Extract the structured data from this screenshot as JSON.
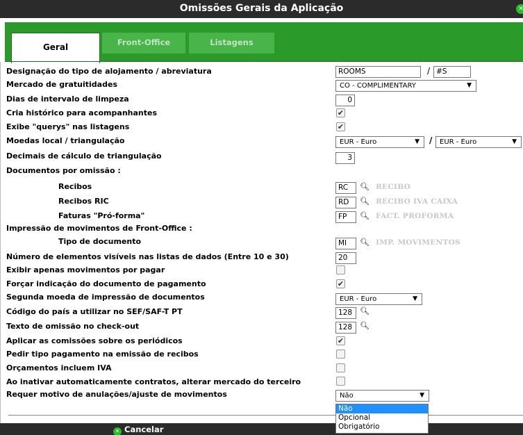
{
  "window": {
    "title": "Omissões Gerais da Aplicação"
  },
  "tabs": [
    {
      "label": "Geral",
      "active": true
    },
    {
      "label": "Front-Office",
      "active": false
    },
    {
      "label": "Listagens",
      "active": false
    }
  ],
  "fields": {
    "tipo_alojamento": {
      "label": "Designação do tipo de alojamento / abreviatura",
      "value": "ROOMS",
      "separator": "/",
      "abbr": "#S"
    },
    "mercado_gratuitidades": {
      "label": "Mercado de gratuitidades",
      "value": "CO - COMPLIMENTARY"
    },
    "dias_limpeza": {
      "label": "Dias de intervalo de limpeza",
      "value": "0"
    },
    "historico_acompanhantes": {
      "label": "Cria histórico para acompanhantes",
      "checked": true
    },
    "exibe_querys": {
      "label": "Exibe \"querys\" nas listagens",
      "checked": true
    },
    "moedas": {
      "label": "Moedas local / triangulação",
      "local": "EUR - Euro",
      "separator": "/",
      "triangulacao": "EUR - Euro"
    },
    "decimais": {
      "label": "Decimais de cálculo de triangulação",
      "value": "3"
    },
    "documentos_omissao": {
      "label": "Documentos por omissão :"
    },
    "recibos": {
      "label": "Recibos",
      "code": "RC",
      "desc": "RECIBO"
    },
    "recibos_ric": {
      "label": "Recibos RIC",
      "code": "RD",
      "desc": "RECIBO IVA CAIXA"
    },
    "faturas_proforma": {
      "label": "Faturas \"Pró-forma\"",
      "code": "FP",
      "desc": "FACT. PROFORMA"
    },
    "impressao_movimentos": {
      "label": "Impressão de movimentos de Front-Office :"
    },
    "tipo_documento": {
      "label": "Tipo de documento",
      "code": "MI",
      "desc": "IMP. MOVIMENTOS"
    },
    "num_elementos": {
      "label": "Número de elementos visíveis nas listas de dados (Entre 10 e 30)",
      "value": "20"
    },
    "exibir_por_pagar": {
      "label": "Exibir apenas movimentos por pagar",
      "checked": false
    },
    "forcar_indicacao": {
      "label": "Forçar indicação do documento de pagamento",
      "checked": true
    },
    "segunda_moeda": {
      "label": "Segunda moeda de impressão de documentos",
      "value": "EUR - Euro"
    },
    "codigo_pais": {
      "label": "Código do país a utilizar no SEF/SAF-T PT",
      "value": "128"
    },
    "texto_checkout": {
      "label": "Texto de omissão no check-out",
      "value": "128"
    },
    "comissoes_periodicos": {
      "label": "Aplicar as comissões sobre os periódicos",
      "checked": true
    },
    "pedir_tipo_pagamento": {
      "label": "Pedir tipo pagamento na emissão de recibos",
      "checked": false
    },
    "orcamentos_iva": {
      "label": "Orçamentos incluem IVA",
      "checked": false
    },
    "inativar_contratos": {
      "label": "Ao inativar automaticamente contratos, alterar mercado do terceiro",
      "checked": false
    },
    "motivo_anulacoes": {
      "label": "Requer motivo de anulações/ajuste de movimentos",
      "value": "Não",
      "options": [
        "Não",
        "Opcional",
        "Obrigatório"
      ]
    }
  },
  "footer": {
    "cancel_label": "Cancelar"
  },
  "colors": {
    "tab_green": "#2a9a2a",
    "titlebar": "#2b2b2b",
    "highlight": "#1e90ff"
  },
  "icons": {
    "lookup": "magnifier-icon",
    "close": "close-icon",
    "cancel": "cancel-icon"
  }
}
